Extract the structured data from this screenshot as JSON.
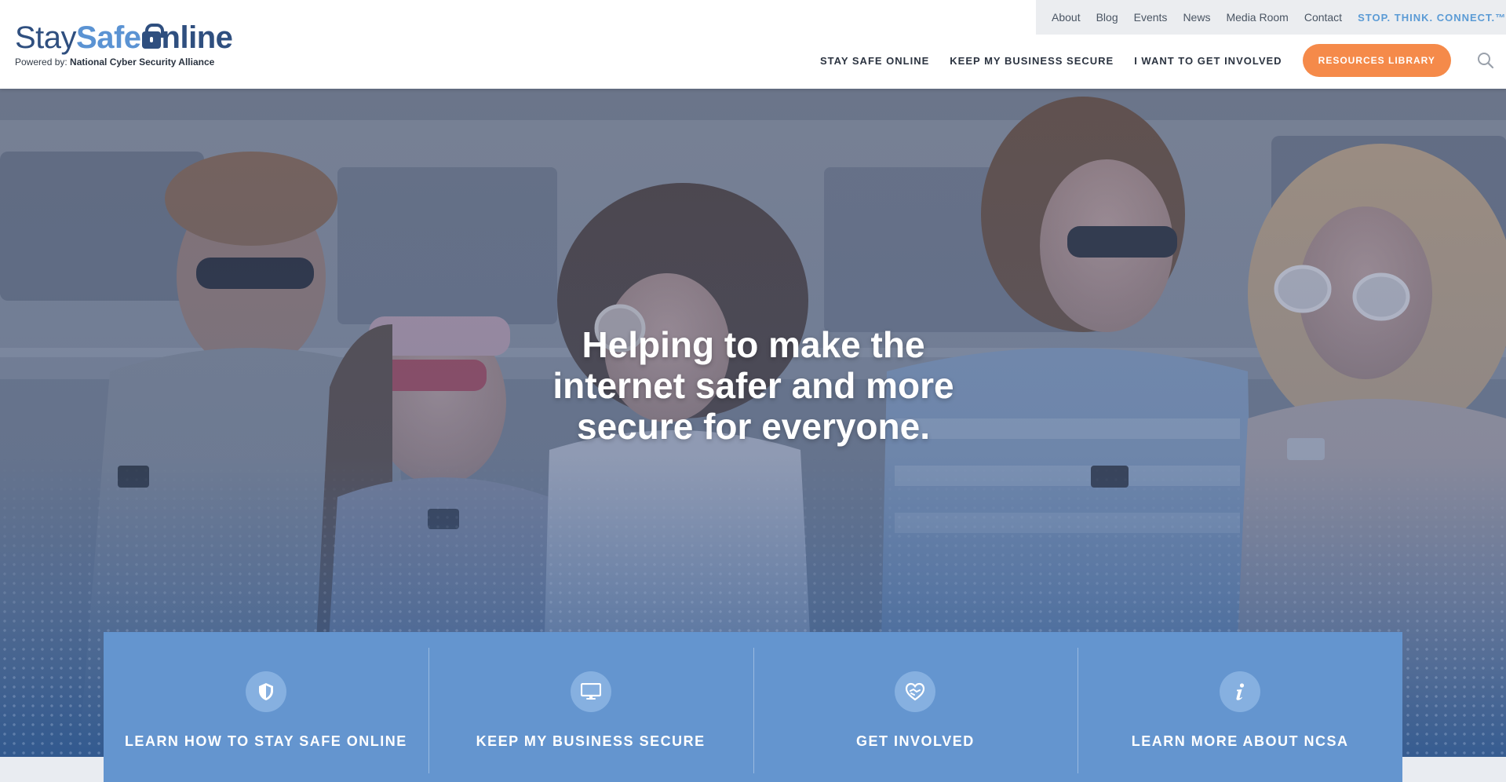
{
  "logo": {
    "stay": "Stay",
    "safe": "Safe",
    "online": "nline",
    "powered_prefix": "Powered by:",
    "powered_org": "National Cyber Security Alliance"
  },
  "utility_nav": {
    "items": [
      "About",
      "Blog",
      "Events",
      "News",
      "Media Room",
      "Contact"
    ],
    "stc": "STOP. THINK. CONNECT.™"
  },
  "main_nav": {
    "items": [
      "STAY SAFE ONLINE",
      "KEEP MY BUSINESS SECURE",
      "I WANT TO GET INVOLVED"
    ],
    "button": "RESOURCES LIBRARY",
    "search_icon": "search-icon"
  },
  "hero": {
    "headline_lines": [
      "Helping to make the",
      "internet safer and more",
      "secure for everyone."
    ]
  },
  "cards": [
    {
      "icon": "shield-icon",
      "label": "LEARN HOW TO STAY SAFE ONLINE"
    },
    {
      "icon": "monitor-icon",
      "label": "KEEP MY BUSINESS SECURE"
    },
    {
      "icon": "heart-hands-icon",
      "label": "GET INVOLVED"
    },
    {
      "icon": "info-icon",
      "label": "LEARN MORE ABOUT NCSA"
    }
  ],
  "colors": {
    "brand_navy": "#2f4f7f",
    "brand_blue": "#5b93d3",
    "accent_orange": "#f58a4a",
    "card_blue": "#6495cf",
    "utility_bar": "#ebedf0"
  }
}
